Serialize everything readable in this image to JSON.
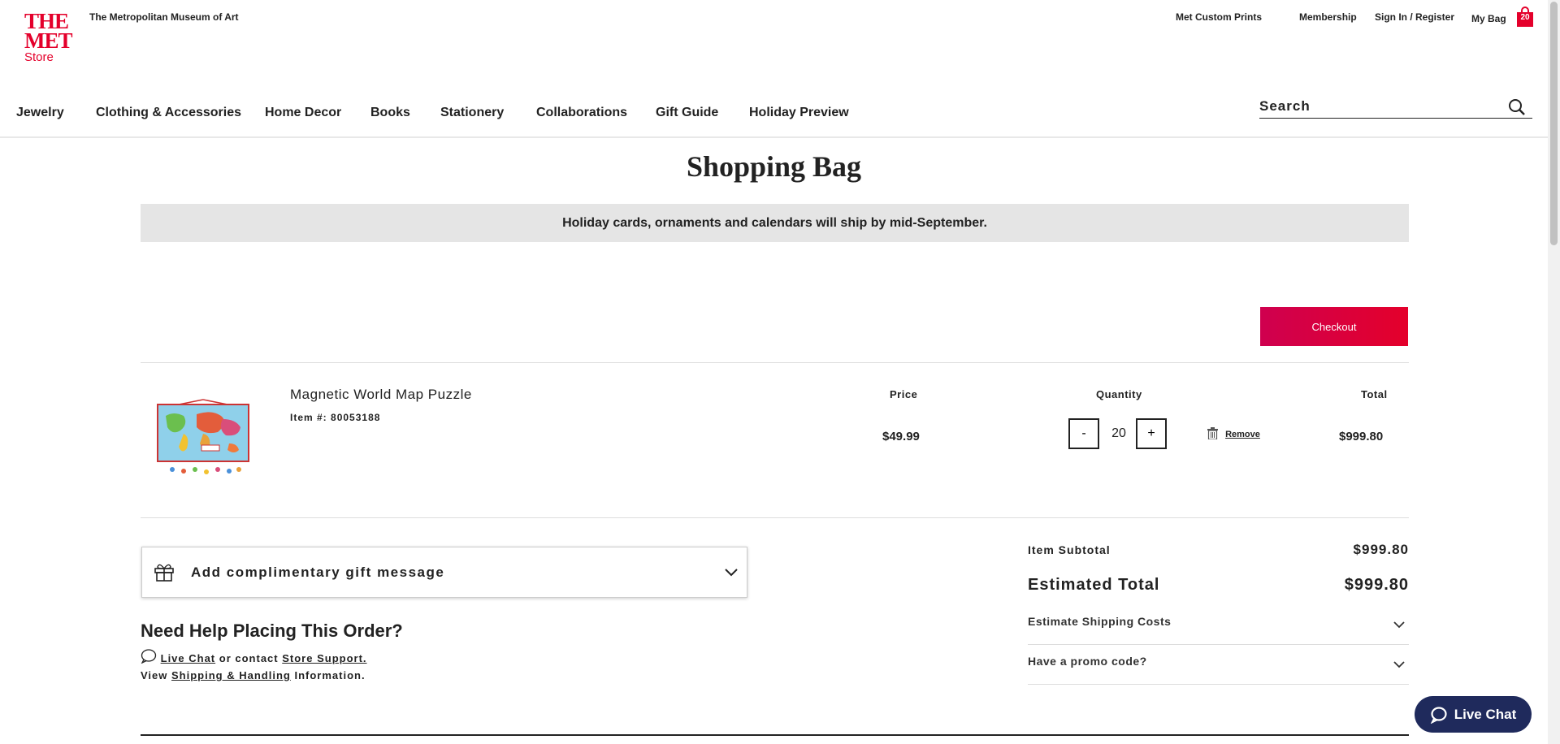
{
  "header": {
    "logo": {
      "line1": "THE",
      "line2": "MET",
      "line3": "Store"
    },
    "museum_name": "The Metropolitan Museum of Art",
    "links": [
      "Met Custom Prints",
      "Membership",
      "Sign In / Register",
      "My Bag"
    ],
    "bag_count": "20",
    "icon_bag": "shopping-bag-icon"
  },
  "nav": {
    "items": [
      "Jewelry",
      "Clothing & Accessories",
      "Home Decor",
      "Books",
      "Stationery",
      "Collaborations",
      "Gift Guide",
      "Holiday Preview"
    ]
  },
  "search": {
    "placeholder": "Search",
    "icon": "search-icon"
  },
  "page": {
    "title": "Shopping Bag",
    "banner": "Holiday cards, ornaments and calendars will ship by mid-September.",
    "checkout_label": "Checkout"
  },
  "cart": {
    "headers": {
      "price": "Price",
      "quantity": "Quantity",
      "total": "Total"
    },
    "item": {
      "name": "Magnetic World Map Puzzle",
      "item_label": "Item #:",
      "item_number": "80053188",
      "price": "$49.99",
      "quantity": "20",
      "minus": "-",
      "plus": "+",
      "remove": "Remove",
      "total": "$999.80"
    }
  },
  "gift": {
    "label": "Add complimentary gift message",
    "icon": "gift-icon"
  },
  "help": {
    "title": "Need Help Placing This Order?",
    "live_chat": "Live Chat",
    "or_contact": "or contact",
    "store_support": "Store Support.",
    "view": "View",
    "shipping": "Shipping & Handling",
    "information": "Information."
  },
  "summary": {
    "subtotal_label": "Item Subtotal",
    "subtotal": "$999.80",
    "estimated_label": "Estimated Total",
    "estimated": "$999.80",
    "shipping_label": "Estimate Shipping Costs",
    "promo_label": "Have a promo code?"
  },
  "chat_widget": {
    "label": "Live Chat"
  },
  "colors": {
    "brand_red": "#e4002b",
    "chat_navy": "#1f2a5c",
    "banner_gray": "#e5e5e5"
  }
}
